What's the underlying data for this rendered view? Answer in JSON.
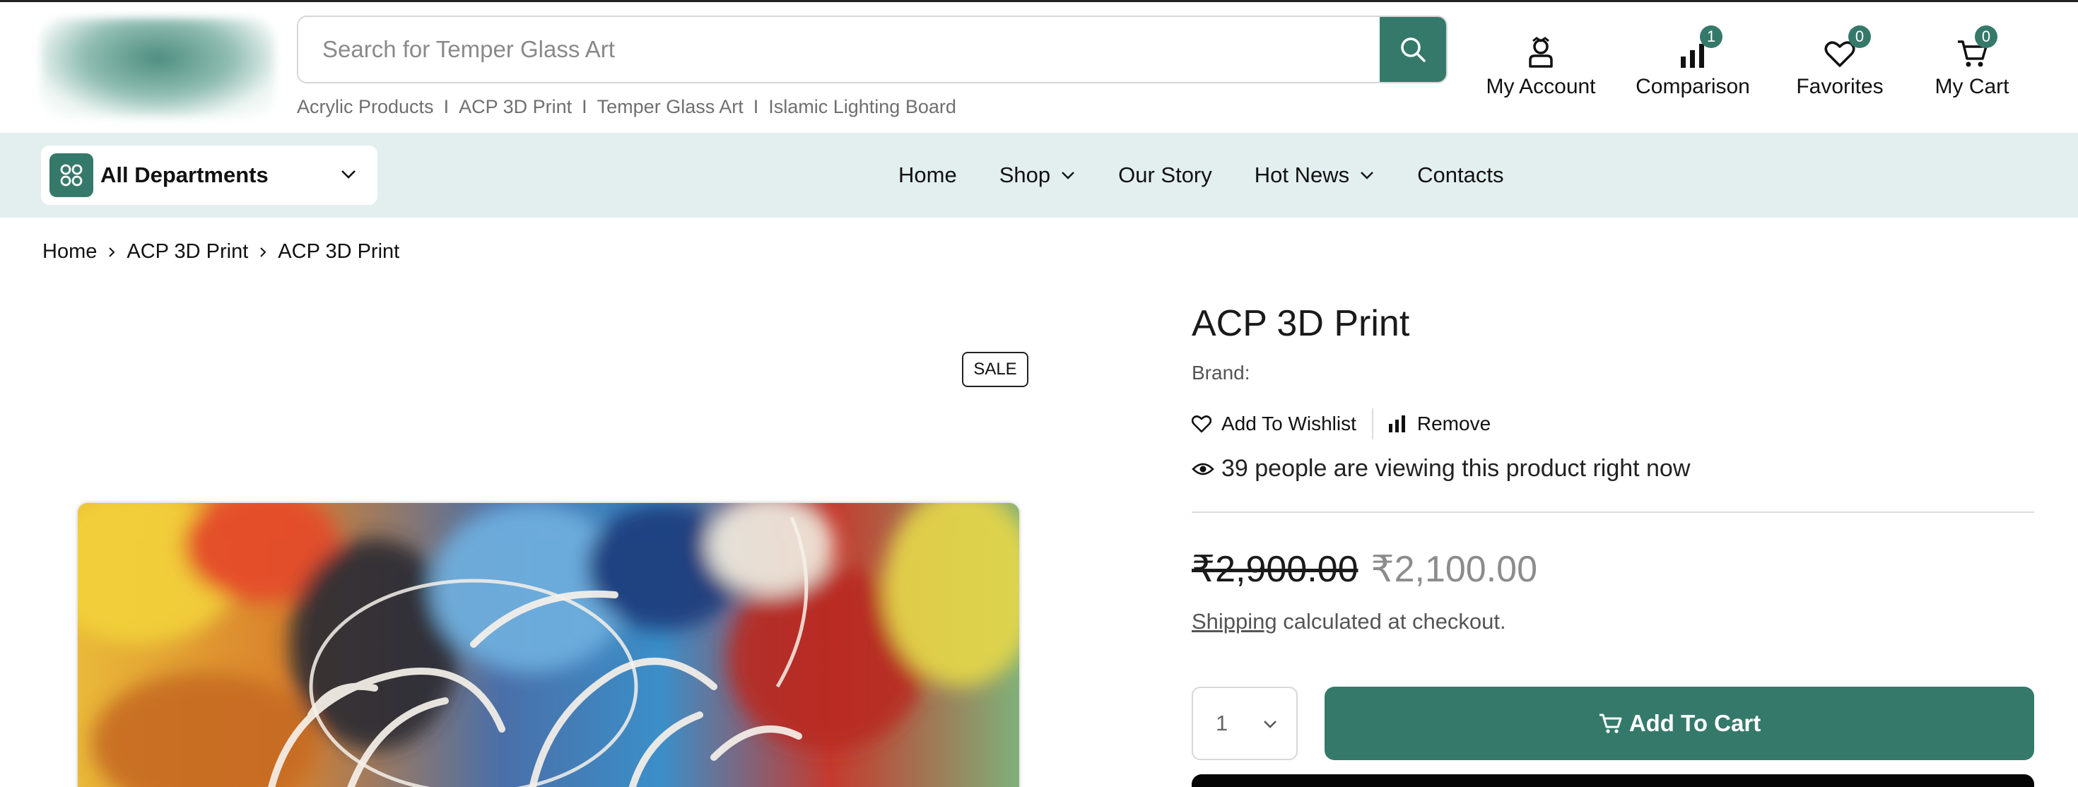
{
  "header": {
    "search": {
      "placeholder": "Search for Temper Glass Art",
      "value": ""
    },
    "quick_links": [
      "Acrylic Products",
      "ACP 3D Print",
      "Temper Glass Art",
      "Islamic Lighting Board"
    ],
    "quick_link_separator": "I",
    "account": {
      "label": "My Account",
      "icon": "user-icon"
    },
    "comparison": {
      "label": "Comparison",
      "count": "1",
      "icon": "bar-chart-icon"
    },
    "favorites": {
      "label": "Favorites",
      "count": "0",
      "icon": "heart-icon"
    },
    "cart": {
      "label": "My Cart",
      "count": "0",
      "icon": "cart-icon"
    }
  },
  "nav": {
    "departments_label": "All Departments",
    "links": [
      {
        "label": "Home",
        "dropdown": false
      },
      {
        "label": "Shop",
        "dropdown": true
      },
      {
        "label": "Our Story",
        "dropdown": false
      },
      {
        "label": "Hot News",
        "dropdown": true
      },
      {
        "label": "Contacts",
        "dropdown": false
      }
    ]
  },
  "breadcrumb": [
    "Home",
    "ACP 3D Print",
    "ACP 3D Print"
  ],
  "product": {
    "sale_badge": "SALE",
    "title": "ACP 3D Print",
    "brand_label": "Brand:",
    "wishlist_label": "Add To Wishlist",
    "remove_label": "Remove",
    "viewing_text": "39 people are viewing this product right now",
    "price_old": "₹2,900.00",
    "price_new": "₹2,100.00",
    "shipping_link": "Shipping",
    "shipping_text": "calculated at checkout.",
    "quantity": "1",
    "add_to_cart_label": "Add To Cart"
  },
  "colors": {
    "accent": "#35796a",
    "nav_background": "#e2efee"
  }
}
